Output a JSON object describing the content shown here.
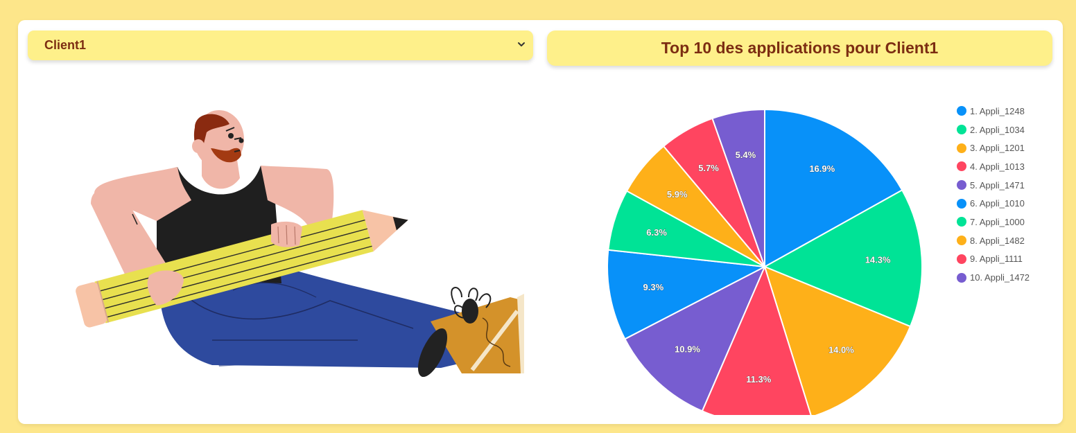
{
  "client_select": {
    "selected": "Client1"
  },
  "chart_title": "Top 10 des applications pour Client1",
  "colors": {
    "page_bg": "#fde68a",
    "panel_bg": "#fef08a",
    "title_text": "#7c2d12"
  },
  "chart_data": {
    "type": "pie",
    "title": "Top 10 des applications pour Client1",
    "legend_position": "right",
    "slices": [
      {
        "name": "1. Appli_1248",
        "value": 16.9,
        "label": "16.9%",
        "color": "#0891f9"
      },
      {
        "name": "2. Appli_1034",
        "value": 14.3,
        "label": "14.3%",
        "color": "#00e396"
      },
      {
        "name": "3. Appli_1201",
        "value": 14.0,
        "label": "14.0%",
        "color": "#feb019"
      },
      {
        "name": "4. Appli_1013",
        "value": 11.3,
        "label": "11.3%",
        "color": "#ff4560"
      },
      {
        "name": "5. Appli_1471",
        "value": 10.9,
        "label": "10.9%",
        "color": "#775dd0"
      },
      {
        "name": "6. Appli_1010",
        "value": 9.3,
        "label": "9.3%",
        "color": "#0891f9"
      },
      {
        "name": "7. Appli_1000",
        "value": 6.3,
        "label": "6.3%",
        "color": "#00e396"
      },
      {
        "name": "8. Appli_1482",
        "value": 5.9,
        "label": "5.9%",
        "color": "#feb019"
      },
      {
        "name": "9. Appli_1111",
        "value": 5.7,
        "label": "5.7%",
        "color": "#ff4560"
      },
      {
        "name": "10. Appli_1472",
        "value": 5.4,
        "label": "5.4%",
        "color": "#775dd0"
      }
    ]
  }
}
